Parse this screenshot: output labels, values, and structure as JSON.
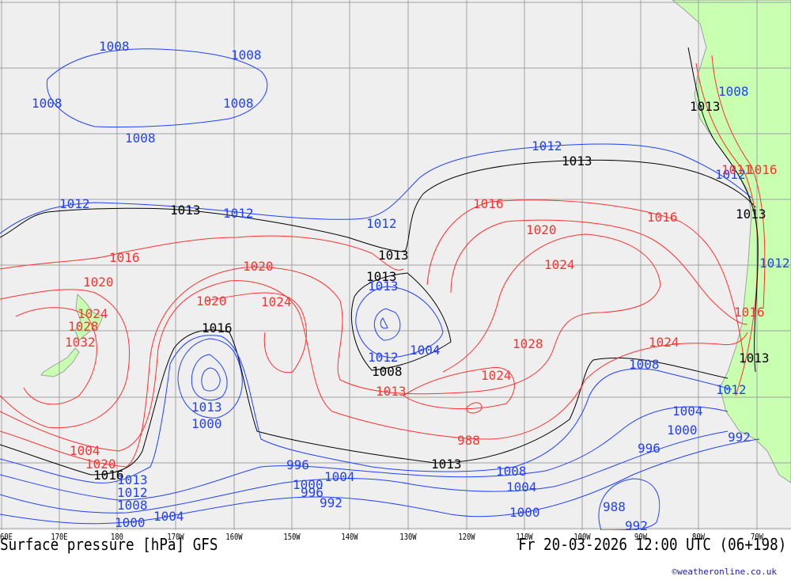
{
  "title": "Surface pressure [hPa] GFS",
  "valid_time": "Fr 20-03-2026 12:00 UTC (06+198)",
  "credit": "©weatheronline.co.uk",
  "longitude_labels": [
    "60E",
    "170E",
    "180",
    "170W",
    "160W",
    "150W",
    "140W",
    "130W",
    "120W",
    "110W",
    "100W",
    "90W",
    "80W",
    "70W"
  ],
  "colors": {
    "ocean": "#efefef",
    "land": "#c8ffb0",
    "grid": "#a0a0a0",
    "high_isobar": "#ff3030",
    "low_isobar": "#2040ff",
    "standard_isobar": "#000000"
  },
  "isobar_labels": [
    "1008",
    "1008",
    "1008",
    "1008",
    "1008",
    "1012",
    "1013",
    "1012",
    "1012",
    "1013",
    "1012",
    "1013",
    "1016",
    "1016",
    "1020",
    "1020",
    "1024",
    "1028",
    "1032",
    "1020",
    "1016",
    "1024",
    "1013",
    "1013",
    "1012",
    "1004",
    "1008",
    "1013",
    "1024",
    "1028",
    "1024",
    "1024",
    "1020",
    "1016",
    "1013",
    "1000",
    "1004",
    "1020",
    "1016",
    "1013",
    "1012",
    "1008",
    "1004",
    "1000",
    "996",
    "1004",
    "1000",
    "996",
    "992",
    "988",
    "1008",
    "1004",
    "1000",
    "988",
    "992",
    "1008",
    "1004",
    "1000",
    "996",
    "992",
    "1013",
    "1012",
    "1008",
    "1013",
    "1011",
    "1016",
    "1012",
    "1013",
    "1016",
    "1013",
    "1012"
  ]
}
